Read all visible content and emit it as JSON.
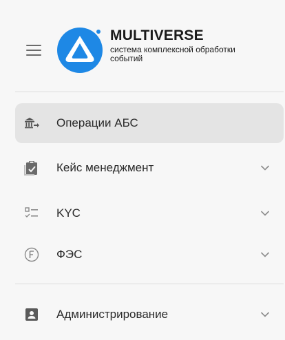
{
  "header": {
    "brand_name": "MULTIVERSE",
    "brand_tagline": "система комплексной обработки событий"
  },
  "nav": {
    "items": [
      {
        "label": "Операции АБС",
        "icon": "bank-transfer-icon",
        "active": true,
        "expandable": false
      },
      {
        "label": "Кейс менеджмент",
        "icon": "clipboard-check-icon",
        "active": false,
        "expandable": true
      },
      {
        "label": "KYC",
        "icon": "checklist-icon",
        "active": false,
        "expandable": true
      },
      {
        "label": "ФЭС",
        "icon": "circle-f-icon",
        "active": false,
        "expandable": true
      },
      {
        "label": "Администрирование",
        "icon": "account-box-icon",
        "active": false,
        "expandable": true
      }
    ]
  },
  "colors": {
    "brand_blue": "#1e88e5",
    "active_bg": "#e4e4e4",
    "icon_gray": "#6b6b6b",
    "text": "#2a2a2a"
  }
}
